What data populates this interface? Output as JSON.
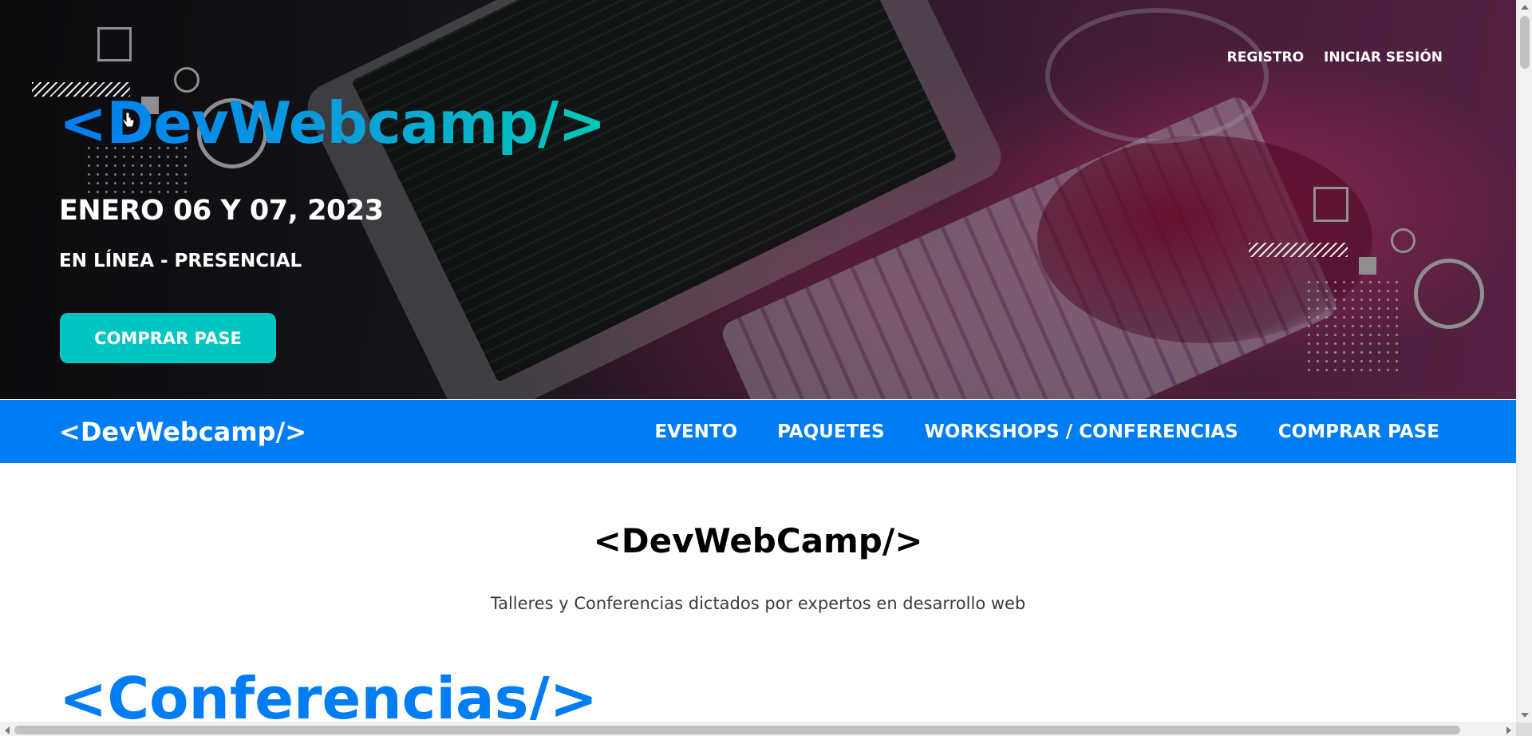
{
  "hero": {
    "logo": "<DevWebcamp/>",
    "date": "ENERO 06 Y 07, 2023",
    "mode": "EN LÍNEA - PRESENCIAL",
    "cta_label": "COMPRAR PASE",
    "top_links": [
      {
        "label": "REGISTRO"
      },
      {
        "label": "INICIAR SESIÓN"
      }
    ]
  },
  "navbar": {
    "logo": "<DevWebcamp/>",
    "links": [
      {
        "label": "EVENTO"
      },
      {
        "label": "PAQUETES"
      },
      {
        "label": "WORKSHOPS / CONFERENCIAS"
      },
      {
        "label": "COMPRAR PASE"
      }
    ]
  },
  "main": {
    "title": "<DevWebCamp/>",
    "description": "Talleres y Conferencias dictados por expertos en desarrollo web",
    "section_title": "<Conferencias/>"
  },
  "colors": {
    "primary_blue": "#007df4",
    "accent_teal": "#00c5c0",
    "text_dark": "#000000"
  }
}
